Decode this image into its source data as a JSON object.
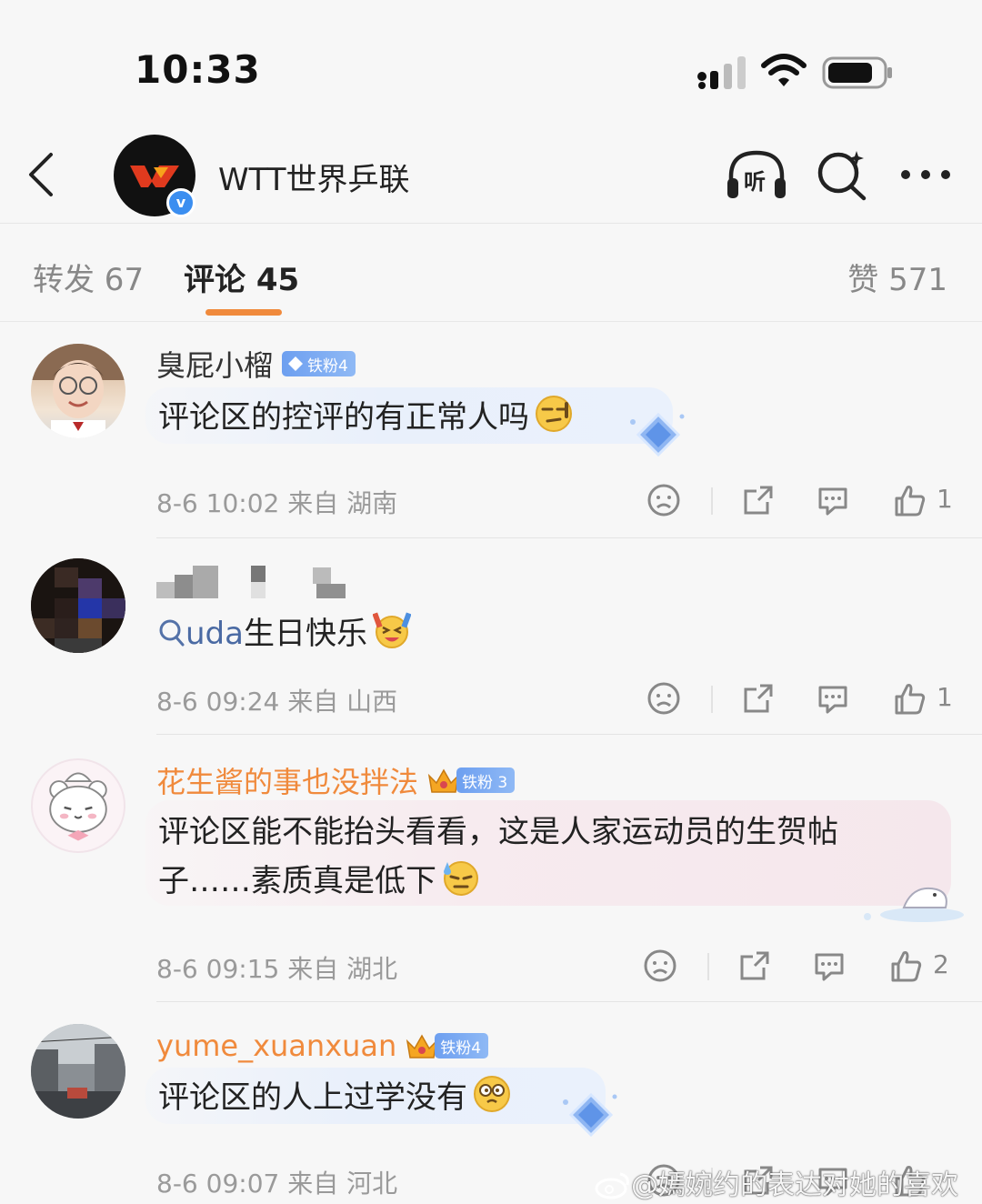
{
  "status_bar": {
    "time": "10:33"
  },
  "header": {
    "account_name": "WTT世界乒联",
    "verified_mark": "v"
  },
  "tabs": {
    "forward": "转发 67",
    "comments": "评论 45",
    "likes": "赞 571"
  },
  "comments": [
    {
      "username": "臭屁小榴",
      "username_color": "#333333",
      "fan_badge": "铁粉4",
      "text_lines": [
        "评论区的控评的有正常人吗"
      ],
      "emoji": "smirk-emoji",
      "meta": "8-6 10:02  来自 湖南",
      "likes": "1"
    },
    {
      "username": "",
      "username_color": "#333333",
      "fan_badge": "",
      "search_keyword": "uda",
      "text_lines": [
        "生日快乐"
      ],
      "emoji": "celebrate-emoji",
      "meta": "8-6 09:24  来自 山西",
      "likes": "1"
    },
    {
      "username": "花生酱的事也没拌法",
      "username_color": "#f08a3c",
      "fan_badge": "铁粉 3",
      "text_lines": [
        "评论区能不能抬头看看，这是人家运动员的生贺帖",
        "子……素质真是低下"
      ],
      "emoji": "sweat-emoji",
      "meta": "8-6 09:15  来自 湖北",
      "likes": "2"
    },
    {
      "username": "yume_xuanxuan",
      "username_color": "#f08a3c",
      "fan_badge": "铁粉4",
      "text_lines": [
        "评论区的人上过学没有"
      ],
      "emoji": "dizzy-emoji",
      "meta": "8-6 09:07  来自 河北",
      "likes": ""
    }
  ],
  "watermark": "@嫣婉约的表达对她的喜欢"
}
